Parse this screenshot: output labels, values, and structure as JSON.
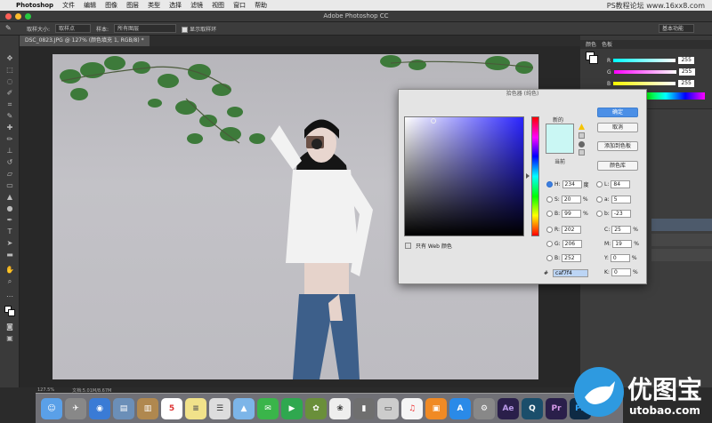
{
  "menubar": {
    "app_name": "Photoshop",
    "menus": [
      "文件",
      "编辑",
      "图像",
      "图层",
      "类型",
      "选择",
      "滤镜",
      "视图",
      "窗口",
      "帮助"
    ],
    "watermark": "PS教程论坛 www.16xx8.com"
  },
  "titlebar": {
    "title": "Adobe Photoshop CC"
  },
  "options": {
    "sample_size_label": "取样大小:",
    "sample_size_value": "取样点",
    "sample_label": "样本:",
    "sample_value": "所有图层",
    "show_ring_label": "显示取样环",
    "workspace": "基本功能"
  },
  "document": {
    "tab_label": "DSC_0823.JPG @ 127% (颜色填充 1, RGB/8) *"
  },
  "status": {
    "zoom": "127.5%",
    "doc_info": "文档:5.01M/8.67M"
  },
  "right_panel": {
    "tabs": [
      "颜色",
      "色板"
    ],
    "r_label": "R",
    "g_label": "G",
    "b_label": "B",
    "r_value": "255",
    "g_value": "255",
    "b_value": "255"
  },
  "picker": {
    "title": "拾色器 (纯色)",
    "new_label": "新的",
    "current_label": "当前",
    "ok": "确定",
    "cancel": "取消",
    "add_to_swatches": "添加到色板",
    "color_libraries": "颜色库",
    "web_only": "只有 Web 颜色",
    "h_label": "H:",
    "h_value": "234",
    "h_unit": "度",
    "s_label": "S:",
    "s_value": "20",
    "s_unit": "%",
    "b_label": "B:",
    "b_value": "99",
    "b_unit": "%",
    "r_label": "R:",
    "r_value": "202",
    "g_label": "G:",
    "g_value": "206",
    "bb_label": "B:",
    "bb_value": "252",
    "l_label": "L:",
    "l_value": "84",
    "a_label": "a:",
    "a_value": "5",
    "lab_b_label": "b:",
    "lab_b_value": "-23",
    "c_label": "C:",
    "c_value": "25",
    "c_unit": "%",
    "m_label": "M:",
    "m_value": "19",
    "m_unit": "%",
    "y_label": "Y:",
    "y_value": "0",
    "y_unit": "%",
    "k_label": "K:",
    "k_value": "0",
    "k_unit": "%",
    "hex_label": "#",
    "hex_value": "caf7f4",
    "swatch_color": "#caf7f4"
  },
  "logo": {
    "text": "优图宝",
    "url": "utobao.com"
  }
}
